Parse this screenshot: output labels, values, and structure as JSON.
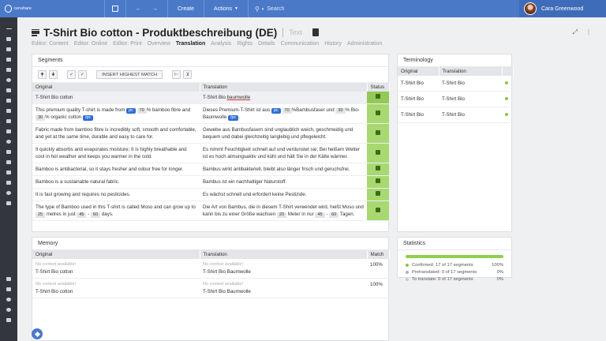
{
  "topbar": {
    "logo": "censhare",
    "create": "Create",
    "actions": "Actions",
    "search_placeholder": "Search",
    "user_name": "Cara Greenwood"
  },
  "header": {
    "title": "T-Shirt Bio cotton - Produktbeschreibung (DE)",
    "type": "Text"
  },
  "tabs": [
    {
      "label": "Editor: Content"
    },
    {
      "label": "Editor: Online"
    },
    {
      "label": "Editor: Print"
    },
    {
      "label": "Overview"
    },
    {
      "label": "Translation",
      "active": true
    },
    {
      "label": "Analysis"
    },
    {
      "label": "Rights"
    },
    {
      "label": "Details"
    },
    {
      "label": "Communication"
    },
    {
      "label": "History"
    },
    {
      "label": "Administration"
    }
  ],
  "segments": {
    "title": "Segments",
    "insert_button": "INSERT HIGHEST MATCH",
    "columns": {
      "original": "Original",
      "translation": "Translation",
      "status": "Status"
    },
    "rows": [
      {
        "original": "T-Shirt Bio cotton",
        "translation_a": "T-Shirt Bio ",
        "translation_b": "baumwolle"
      },
      {
        "orig_a": "This premium quality T-shirt is made from ",
        "tag1": "pc",
        "n1": "70",
        "orig_b": "% bamboo fibre and",
        "n2": "30",
        "orig_c": "% organic cotton",
        "tag2": "/pc",
        "orig_d": ".",
        "tr_a": "Dieses Premium-T-Shirt ist aus ",
        "ttag1": "pc",
        "tn1": "70",
        "tr_b": "%Bambusfaser und ",
        "tn2": "30",
        "tr_c": "% Bio-Baumwolle ",
        "ttag2": "/pc",
        "tr_d": "."
      },
      {
        "original": "Fabric made from bamboo fibre is incredibly soft, smooth and comfortable, and yet at the same time, durable and easy to care for.",
        "translation": "Gewebe aus Bambusfasern sind unglaublich weich, geschmeidig und bequem und dabei gleichzeitig langlebig und pflegeleicht."
      },
      {
        "original": "It quickly absorbs and evaporates moisture; It is highly breathable and cool in hot weather and keeps you warmer in the cold.",
        "translation": "Es nimmt Feuchtigkeit schnell auf und verdunstet sie; Bei heißem Wetter ist es hoch atmungsaktiv und kühl und hält Sie in der Kälte wärmer."
      },
      {
        "original": "Bamboo is antibacterial, so it stays fresher and odour free for longer.",
        "translation": "Bambus wirkt antibakteriell, bleibt also länger frisch und geruchsfrei."
      },
      {
        "original": "Bamboo is a sustainable natural fabric.",
        "translation": "Bambus ist ein nachhaltiger Naturstoff."
      },
      {
        "original": "It is fast growing and requires no pesticides.",
        "translation": "Es wächst schnell und erfordert keine Pestizide."
      },
      {
        "orig_a": "The type of Bamboo used in this T-shirt is called Moso and can grow up to ",
        "n1": "25",
        "orig_b": " metres in just ",
        "n2": "45",
        "n3": "60",
        "orig_c": " days.",
        "tr_a": "Die Art von Bambus, die in diesem T-Shirt verwendet wird, heißt Moso und kann bis zu einer Größe wachsen ",
        "tn1": "20",
        "tr_b": " Meter in nur ",
        "tn2": "45",
        "tn3": "60",
        "tr_c": " Tagen."
      }
    ],
    "range_sep": "-"
  },
  "terminology": {
    "title": "Terminology",
    "columns": {
      "original": "Original",
      "translation": "Translation"
    },
    "rows": [
      {
        "original": "T-Shirt Bio",
        "translation": "T-Shirt Bio"
      },
      {
        "original": "T-Shirt Bio",
        "translation": "T-Shirt Bio"
      },
      {
        "original": "T-Shirt Bio",
        "translation": "T-Shirt Bio"
      }
    ]
  },
  "memory": {
    "title": "Memory",
    "columns": {
      "original": "Original",
      "translation": "Translation",
      "match": "Match"
    },
    "rows": [
      {
        "noctx": "No context available!",
        "original": "T-Shirt Bio cotton",
        "noctx_t": "No context available!",
        "translation": "T-Shirt Bio Baumwolle",
        "match": "100%"
      },
      {
        "noctx": "No context available!",
        "original": "T-Shirt Bio cotton",
        "noctx_t": "No context available!",
        "translation": "T-Shirt Bio Baumwolle",
        "match": "100%"
      }
    ]
  },
  "statistics": {
    "title": "Statistics",
    "progress": 1.0,
    "rows": [
      {
        "label": "Confirmed: 17 of 17 segments",
        "value": "100%",
        "color": "#8bc34a"
      },
      {
        "label": "Pretranslated: 0 of 17 segments",
        "value": "0%",
        "color": "#9fb8c9"
      },
      {
        "label": "To translate: 0 of 17 segments",
        "value": "0%",
        "color": "#c9cdd2"
      }
    ]
  }
}
